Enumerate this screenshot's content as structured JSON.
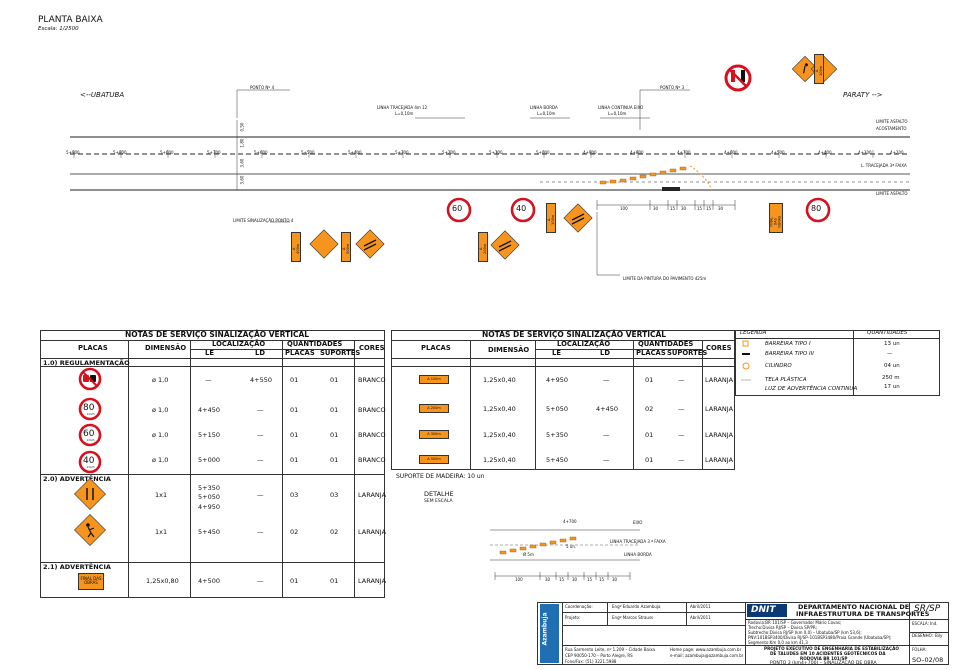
{
  "header": {
    "title": "PLANTA BAIXA",
    "scale": "Escala: 1/2500"
  },
  "plan": {
    "dir_left": "<--UBATUBA",
    "dir_right": "PARATY -->",
    "point4": "PONTO Nº 4",
    "point3": "PONTO Nº 3",
    "line_tracejada": "LINHA TRACEJADA 4m 12",
    "line_tracejada_l": "L=0,10m",
    "line_borda": "LINHA BORDA",
    "line_borda_l": "L=0,10m",
    "line_continua": "LINHA CONTINUA EIXO",
    "line_continua_l": "L=0,10m",
    "limite_asfalto_top": "LIMITE ASFALTO",
    "acostamento": "ACOSTAMENTO",
    "tracejada_faixa": "L. TRACEJADA 3ª FAIXA",
    "limite_asfalto_bottom": "LIMITE ASFALTO",
    "limite_sinalizacao": "LIMITE SINALIZAÇÃO PONTO 4",
    "limite_pintura": "LIMITE DA PINTURA DO PAVIMENTO 425m",
    "stations": [
      "5+900",
      "5+800",
      "5+600",
      "5+700",
      "5+600",
      "5+500",
      "5+400",
      "5+300",
      "5+200",
      "5+100",
      "5+000",
      "4+900",
      "4+800",
      "4+700",
      "4+600",
      "4+500",
      "4+400",
      "4+300",
      "4+200"
    ],
    "widths": [
      "0,50",
      "1,80",
      "3,60",
      "3,60"
    ],
    "dims": [
      "100",
      "30",
      "15",
      "30",
      "15",
      "15",
      "30"
    ],
    "sign_texts": [
      "A 400m",
      "A 500m",
      "A 200m",
      "A 100m",
      "FINAL DAS OBRAS",
      "A 100m"
    ],
    "speed_signs": [
      "60",
      "40",
      "80"
    ]
  },
  "table1": {
    "title": "NOTAS DE SERVIÇO SINALIZAÇÃO VERTICAL",
    "headers": {
      "placas": "PLACAS",
      "dimensao": "DIMENSÃO",
      "localizacao": "LOCALIZAÇÃO",
      "le": "LE",
      "ld": "LD",
      "quantidades": "QUANTIDADES",
      "q_placas": "PLACAS",
      "q_suportes": "SUPORTES",
      "cores": "CORES"
    },
    "sections": [
      "1.0) REGULAMENTAÇÃO",
      "2.0) ADVERTÊNCIA",
      "2.1) ADVERTÊNCIA"
    ],
    "rows": [
      {
        "sign": "no-overtake",
        "dim": "ø 1,0",
        "le": "—",
        "ld": "4+550",
        "qp": "01",
        "qs": "01",
        "cor": "BRANCO"
      },
      {
        "sign": "80",
        "dim": "ø 1,0",
        "le": "4+450",
        "ld": "—",
        "qp": "01",
        "qs": "01",
        "cor": "BRANCO"
      },
      {
        "sign": "60",
        "dim": "ø 1,0",
        "le": "5+150",
        "ld": "—",
        "qp": "01",
        "qs": "01",
        "cor": "BRANCO"
      },
      {
        "sign": "40",
        "dim": "ø 1,0",
        "le": "5+000",
        "ld": "—",
        "qp": "01",
        "qs": "01",
        "cor": "BRANCO"
      },
      {
        "sign": "lane-shift",
        "dim": "1x1",
        "le": "5+350\n5+050\n4+950",
        "ld": "—",
        "qp": "03",
        "qs": "03",
        "cor": "LARANJA"
      },
      {
        "sign": "workers",
        "dim": "1x1",
        "le": "5+450",
        "ld": "—",
        "qp": "02",
        "qs": "02",
        "cor": "LARANJA"
      },
      {
        "sign": "FINAL DAS OBRAS",
        "dim": "1,25x0,80",
        "le": "4+500",
        "ld": "—",
        "qp": "01",
        "qs": "01",
        "cor": "LARANJA"
      }
    ],
    "speed_unit": "km/h"
  },
  "table2": {
    "title": "NOTAS DE SERVIÇO SINALIZAÇÃO VERTICAL",
    "rows": [
      {
        "sign": "A 100m",
        "dim": "1,25x0,40",
        "le": "4+950",
        "ld": "—",
        "qp": "01",
        "qs": "—",
        "cor": "LARANJA"
      },
      {
        "sign": "A 200m",
        "dim": "1,25x0,40",
        "le": "5+050",
        "ld": "4+450",
        "qp": "02",
        "qs": "—",
        "cor": "LARANJA"
      },
      {
        "sign": "A 300m",
        "dim": "1,25x0,40",
        "le": "5+350",
        "ld": "—",
        "qp": "01",
        "qs": "—",
        "cor": "LARANJA"
      },
      {
        "sign": "A 500m",
        "dim": "1,25x0,40",
        "le": "5+450",
        "ld": "—",
        "qp": "01",
        "qs": "—",
        "cor": "LARANJA"
      }
    ],
    "suporte": "SUPORTE DE MADEIRA: 10 un",
    "detalhe": "DETALHE",
    "sem_escala": "SEM ESCALA",
    "det_labels": [
      "4+700",
      "EIXO",
      "LINHA TRACEJADA 3 ª FAIXA",
      "LINHA BORDA",
      "5 un.",
      "Ø 5m"
    ]
  },
  "legend": {
    "title": "LEGENDA",
    "qty_title": "QUANTIDADES",
    "items": [
      {
        "label": "BARREIRA TIPO I",
        "qty": "13 un"
      },
      {
        "label": "BARREIRA TIPO III",
        "qty": "—"
      },
      {
        "label": "CILINDRO",
        "qty": "04 un"
      },
      {
        "label": "TELA PLÁSTICA",
        "qty": "250 m"
      },
      {
        "label": "LUZ DE ADVERTÊNCIA CONTINUA",
        "qty": "17 un"
      }
    ]
  },
  "titleblock": {
    "company": "Azambuja",
    "coord_label": "Coordenação:",
    "coord_name": "Engº Eduardo Azambuja",
    "coord_date": "Abril/2011",
    "proj_label": "Projeto:",
    "proj_name": "Engº Marcos Strauss",
    "proj_date": "Abril/2011",
    "addr1": "Rua Sarmento Leite, nº 1.209 – Cidade Baixa",
    "addr2": "CEP 90050-170 – Porto Alegre, RS",
    "addr3": "Fone/Fax: (51) 3221.5988",
    "web1": "Home page: www.azambuja.com.br",
    "web2": "e-mail: azambuja@azambuja.com.br",
    "dnit": "DNIT",
    "dept1": "DEPARTAMENTO NACIONAL DE",
    "dept2": "INFRAESTRUTURA DE TRANSPORTES",
    "state": "SR/SP",
    "info1": "Rodovia:BR 101/SP – Governador Mário Covas;",
    "info2": "Trecho:Divisa RJ/SP – Divisa SP/PR;",
    "info3": "Subtrecho:Divisa RJ/SP (km 0,0) – Ubatuba/SP (km 53,6);",
    "info4": "PNV:101BSP3400/Divisa RJ/SP–101BSP3480/Praia Grande (Ubatuba/SP);",
    "info5": "Segmento:Km 0,0 ao km 41,3",
    "escala_l": "ESCALA:",
    "escala_v": "Ind.",
    "desenho_l": "DESENHO:",
    "desenho_v": "Bily",
    "proj1": "PROJETO EXECUTIVO DE ENGENHARIA DE ESTABILIZAÇÃO",
    "proj2": "DE TALUDES EM 10 ACIDENTES GEOTÉCNICOS DA",
    "proj3": "RODOVIA BR 101/SP",
    "ponto": "PONTO 3 (km4+700) – SINALIZAÇÃO DE OBRA",
    "folha_l": "FOLHA:",
    "folha_v": "SO–02/08"
  }
}
